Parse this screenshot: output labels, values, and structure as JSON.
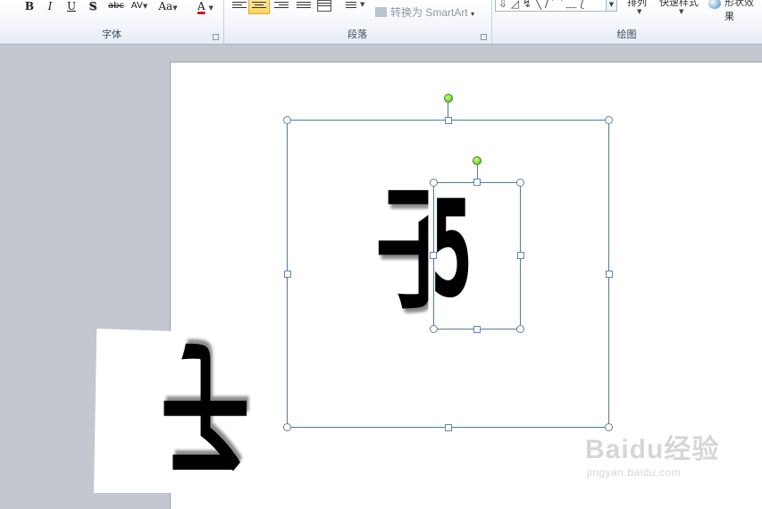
{
  "ribbon": {
    "font_group": {
      "label": "字体",
      "buttons": {
        "bold": "B",
        "italic": "I",
        "underline": "U",
        "shadow": "S",
        "strikethrough": "abc",
        "char_spacing": "AV",
        "change_case": "Aa",
        "font_color": "A"
      }
    },
    "paragraph_group": {
      "label": "段落",
      "convert_smartart": "转换为 SmartArt"
    },
    "drawing_group": {
      "label": "绘图",
      "arrange_cut": "排列",
      "quick_styles_cut": "快速样式",
      "shape_effects_cut": "形状效果"
    }
  },
  "canvas": {
    "glyph_main": "子",
    "glyph_partial": "5",
    "glyph_scrap": "子"
  },
  "watermark": {
    "logo": "Baidu经验",
    "url": "jingyan.baidu.com"
  },
  "colors": {
    "font_color_bar": "#d9141b",
    "rotate_handle": "#6fd022",
    "selection_border": "#547aa0",
    "active_align": "#ffd35c"
  }
}
